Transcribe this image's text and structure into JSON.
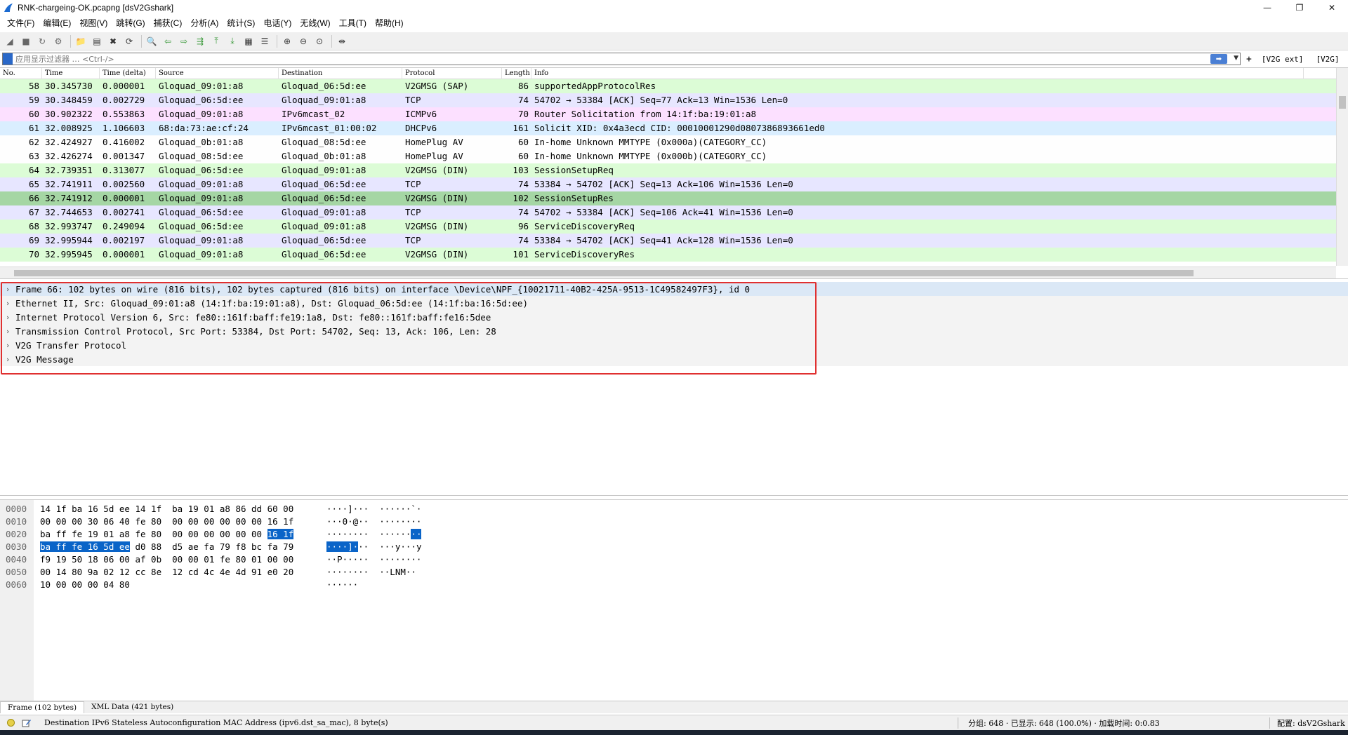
{
  "window": {
    "title": "RNK-chargeing-OK.pcapng [dsV2Gshark]",
    "controls": {
      "minimize": "—",
      "restore": "❐",
      "close": "✕"
    }
  },
  "menu": [
    "文件(F)",
    "编辑(E)",
    "视图(V)",
    "跳转(G)",
    "捕获(C)",
    "分析(A)",
    "统计(S)",
    "电话(Y)",
    "无线(W)",
    "工具(T)",
    "帮助(H)"
  ],
  "toolbar_icons": [
    "shark-fin-start-icon",
    "stop-square-icon",
    "restart-shark-icon",
    "capture-options-gear-icon",
    "open-folder-icon",
    "save-file-icon",
    "close-file-icon",
    "reload-icon",
    "find-magnifier-icon",
    "go-back-arrow-icon",
    "go-forward-arrow-icon",
    "go-to-packet-icon",
    "go-first-icon",
    "go-last-icon",
    "autoscroll-icon",
    "colorize-icon",
    "zoom-in-icon",
    "zoom-out-icon",
    "zoom-normal-icon",
    "resize-columns-icon"
  ],
  "filter": {
    "placeholder": "应用显示过滤器 … <Ctrl-/>",
    "value": "",
    "plus": "+",
    "buttons": [
      "[V2G ext]",
      "[V2G]"
    ]
  },
  "packet_list": {
    "columns": [
      "No.",
      "Time",
      "Time (delta)",
      "Source",
      "Destination",
      "Protocol",
      "Length",
      "Info"
    ],
    "rows": [
      {
        "no": "58",
        "time": "30.345730",
        "delta": "0.000001",
        "src": "Gloquad_09:01:a8",
        "dst": "Gloquad_06:5d:ee",
        "proto": "V2GMSG (SAP)",
        "len": "86",
        "info": "supportedAppProtocolRes",
        "color": "green"
      },
      {
        "no": "59",
        "time": "30.348459",
        "delta": "0.002729",
        "src": "Gloquad_06:5d:ee",
        "dst": "Gloquad_09:01:a8",
        "proto": "TCP",
        "len": "74",
        "info": "54702 → 53384 [ACK] Seq=77 Ack=13 Win=1536 Len=0",
        "color": "tcp"
      },
      {
        "no": "60",
        "time": "30.902322",
        "delta": "0.553863",
        "src": "Gloquad_09:01:a8",
        "dst": "IPv6mcast_02",
        "proto": "ICMPv6",
        "len": "70",
        "info": "Router Solicitation from 14:1f:ba:19:01:a8",
        "color": "icmp"
      },
      {
        "no": "61",
        "time": "32.008925",
        "delta": "1.106603",
        "src": "68:da:73:ae:cf:24",
        "dst": "IPv6mcast_01:00:02",
        "proto": "DHCPv6",
        "len": "161",
        "info": "Solicit XID: 0x4a3ecd CID: 00010001290d0807386893661ed0",
        "color": "dhcp"
      },
      {
        "no": "62",
        "time": "32.424927",
        "delta": "0.416002",
        "src": "Gloquad_0b:01:a8",
        "dst": "Gloquad_08:5d:ee",
        "proto": "HomePlug AV",
        "len": "60",
        "info": "In-home Unknown MMTYPE (0x000a)(CATEGORY_CC)",
        "color": "white"
      },
      {
        "no": "63",
        "time": "32.426274",
        "delta": "0.001347",
        "src": "Gloquad_08:5d:ee",
        "dst": "Gloquad_0b:01:a8",
        "proto": "HomePlug AV",
        "len": "60",
        "info": "In-home Unknown MMTYPE (0x000b)(CATEGORY_CC)",
        "color": "white"
      },
      {
        "no": "64",
        "time": "32.739351",
        "delta": "0.313077",
        "src": "Gloquad_06:5d:ee",
        "dst": "Gloquad_09:01:a8",
        "proto": "V2GMSG (DIN)",
        "len": "103",
        "info": "SessionSetupReq",
        "color": "green"
      },
      {
        "no": "65",
        "time": "32.741911",
        "delta": "0.002560",
        "src": "Gloquad_09:01:a8",
        "dst": "Gloquad_06:5d:ee",
        "proto": "TCP",
        "len": "74",
        "info": "53384 → 54702 [ACK] Seq=13 Ack=106 Win=1536 Len=0",
        "color": "tcp"
      },
      {
        "no": "66",
        "time": "32.741912",
        "delta": "0.000001",
        "src": "Gloquad_09:01:a8",
        "dst": "Gloquad_06:5d:ee",
        "proto": "V2GMSG (DIN)",
        "len": "102",
        "info": "SessionSetupRes",
        "color": "selected"
      },
      {
        "no": "67",
        "time": "32.744653",
        "delta": "0.002741",
        "src": "Gloquad_06:5d:ee",
        "dst": "Gloquad_09:01:a8",
        "proto": "TCP",
        "len": "74",
        "info": "54702 → 53384 [ACK] Seq=106 Ack=41 Win=1536 Len=0",
        "color": "tcp"
      },
      {
        "no": "68",
        "time": "32.993747",
        "delta": "0.249094",
        "src": "Gloquad_06:5d:ee",
        "dst": "Gloquad_09:01:a8",
        "proto": "V2GMSG (DIN)",
        "len": "96",
        "info": "ServiceDiscoveryReq",
        "color": "green"
      },
      {
        "no": "69",
        "time": "32.995944",
        "delta": "0.002197",
        "src": "Gloquad_09:01:a8",
        "dst": "Gloquad_06:5d:ee",
        "proto": "TCP",
        "len": "74",
        "info": "53384 → 54702 [ACK] Seq=41 Ack=128 Win=1536 Len=0",
        "color": "tcp"
      },
      {
        "no": "70",
        "time": "32.995945",
        "delta": "0.000001",
        "src": "Gloquad_09:01:a8",
        "dst": "Gloquad_06:5d:ee",
        "proto": "V2GMSG (DIN)",
        "len": "101",
        "info": "ServiceDiscoveryRes",
        "color": "green"
      }
    ]
  },
  "details": [
    "Frame 66: 102 bytes on wire (816 bits), 102 bytes captured (816 bits) on interface \\Device\\NPF_{10021711-40B2-425A-9513-1C49582497F3}, id 0",
    "Ethernet II, Src: Gloquad_09:01:a8 (14:1f:ba:19:01:a8), Dst: Gloquad_06:5d:ee (14:1f:ba:16:5d:ee)",
    "Internet Protocol Version 6, Src: fe80::161f:baff:fe19:1a8, Dst: fe80::161f:baff:fe16:5dee",
    "Transmission Control Protocol, Src Port: 53384, Dst Port: 54702, Seq: 13, Ack: 106, Len: 28",
    "V2G Transfer Protocol",
    "V2G Message"
  ],
  "details_chevron": "›",
  "hex": {
    "offsets": [
      "0000",
      "0010",
      "0020",
      "0030",
      "0040",
      "0050",
      "0060"
    ],
    "lines": [
      {
        "pre": "14 1f ba 16 5d ee 14 1f  ba 19 01 a8 86 dd 60 00",
        "hl": "",
        "post": ""
      },
      {
        "pre": "00 00 00 30 06 40 fe 80  00 00 00 00 00 00 16 1f",
        "hl": "",
        "post": ""
      },
      {
        "pre": "ba ff fe 19 01 a8 fe 80  00 00 00 00 00 00 ",
        "hl": "16 1f",
        "post": ""
      },
      {
        "pre": "",
        "hl": "ba ff fe 16 5d ee",
        "post": " d0 88  d5 ae fa 79 f8 bc fa 79"
      },
      {
        "pre": "f9 19 50 18 06 00 af 0b  00 00 01 fe 80 01 00 00",
        "hl": "",
        "post": ""
      },
      {
        "pre": "00 14 80 9a 02 12 cc 8e  12 cd 4c 4e 4d 91 e0 20",
        "hl": "",
        "post": ""
      },
      {
        "pre": "10 00 00 00 04 80",
        "hl": "",
        "post": ""
      }
    ],
    "ascii": [
      {
        "pre": "····]···  ······`·",
        "hl": "",
        "post": ""
      },
      {
        "pre": "···0·@··  ········",
        "hl": "",
        "post": ""
      },
      {
        "pre": "········  ······",
        "hl": "··",
        "post": ""
      },
      {
        "pre": "",
        "hl": "····]·",
        "post": "··  ···y···y"
      },
      {
        "pre": "··P·····  ········",
        "hl": "",
        "post": ""
      },
      {
        "pre": "········  ··LNM··",
        "hl": "",
        "post": ""
      },
      {
        "pre": "······",
        "hl": "",
        "post": ""
      }
    ]
  },
  "bottom_tabs": [
    "Frame (102 bytes)",
    "XML Data (421 bytes)"
  ],
  "status": {
    "message": "Destination IPv6 Stateless Autoconfiguration MAC Address (ipv6.dst_sa_mac), 8 byte(s)",
    "stats": "分组: 648 · 已显示: 648 (100.0%)   ·   加载时间: 0:0.83",
    "profile": "配置: dsV2Gshark"
  },
  "colors": {
    "green": "#dcfcd6",
    "tcp": "#e7e6ff",
    "icmp": "#fce0ff",
    "dhcp": "#daeeff",
    "white": "#fefefe",
    "selected": "#a5d6a4",
    "hex_highlight": "#0a64c8",
    "annotation_box": "#e03030"
  }
}
